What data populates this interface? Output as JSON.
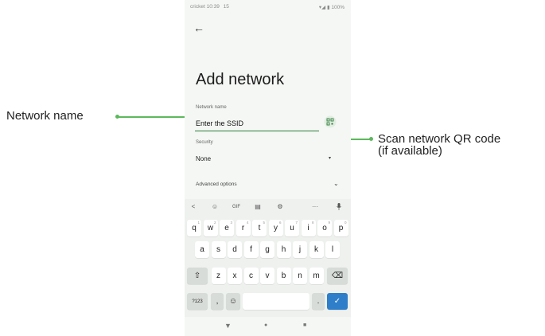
{
  "annotations": {
    "left_label": "Network name",
    "right_label_line1": "Scan network QR code",
    "right_label_line2": "(if available)",
    "accent_color": "#5cb85c"
  },
  "status_bar": {
    "carrier_time": "cricket 10:39",
    "indicator": "15",
    "signal_battery": "100%"
  },
  "screen": {
    "back_icon": "arrow-left-icon",
    "title": "Add network",
    "network_name_label": "Network name",
    "network_name_placeholder": "Enter the SSID",
    "qr_icon": "qr-scan-icon",
    "security_label": "Security",
    "security_value": "None",
    "advanced_label": "Advanced options"
  },
  "keyboard": {
    "toolbar": [
      "<",
      "☺",
      "GIF",
      "▤",
      "⚙",
      "···",
      "🎤"
    ],
    "row1": [
      {
        "k": "q",
        "h": "1"
      },
      {
        "k": "w",
        "h": "2"
      },
      {
        "k": "e",
        "h": "3"
      },
      {
        "k": "r",
        "h": "4"
      },
      {
        "k": "t",
        "h": "5"
      },
      {
        "k": "y",
        "h": "6"
      },
      {
        "k": "u",
        "h": "7"
      },
      {
        "k": "i",
        "h": "8"
      },
      {
        "k": "o",
        "h": "9"
      },
      {
        "k": "p",
        "h": "0"
      }
    ],
    "row2": [
      "a",
      "s",
      "d",
      "f",
      "g",
      "h",
      "j",
      "k",
      "l"
    ],
    "row3": [
      "z",
      "x",
      "c",
      "v",
      "b",
      "n",
      "m"
    ],
    "shift": "⇧",
    "backspace": "⌫",
    "symbols": "?123",
    "comma": ",",
    "emoji": "☺",
    "period": ".",
    "enter": "✓",
    "accent_color": "#2e7ec9"
  },
  "navbar": {
    "back": "▼",
    "home": "●",
    "recents": "■"
  }
}
